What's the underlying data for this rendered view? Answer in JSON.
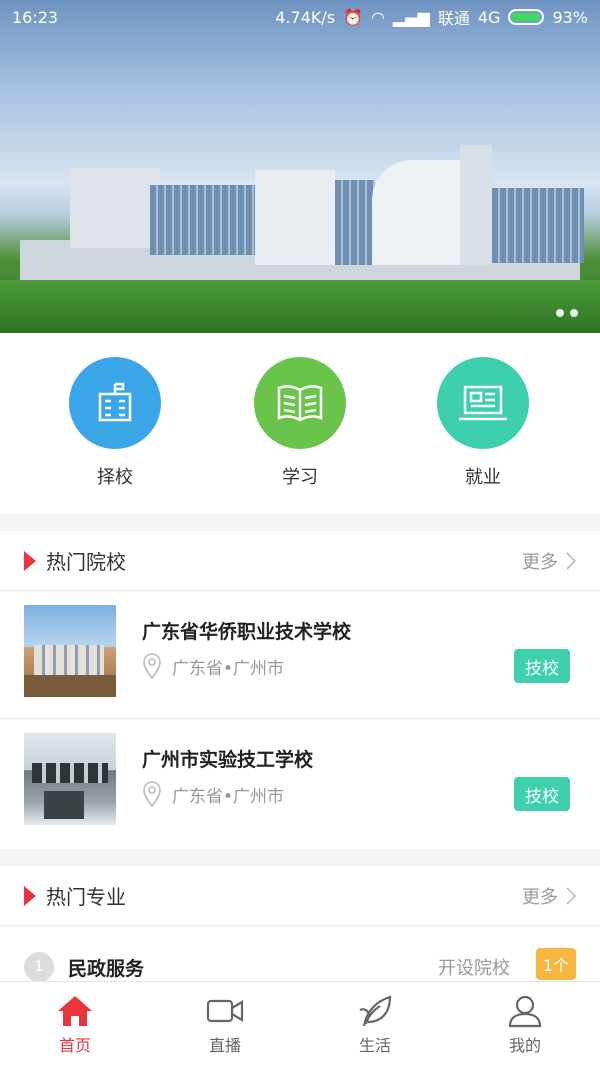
{
  "status": {
    "time": "16:23",
    "speed": "4.74K/s",
    "carrier": "联通",
    "network": "4G",
    "battery": "93%"
  },
  "banner": {
    "page_count": 2
  },
  "quick_actions": [
    {
      "label": "择校",
      "color": "#3aa6e8",
      "icon": "school-building-icon"
    },
    {
      "label": "学习",
      "color": "#6ac34b",
      "icon": "open-book-icon"
    },
    {
      "label": "就业",
      "color": "#3ecfae",
      "icon": "laptop-icon"
    }
  ],
  "hot_schools": {
    "title": "热门院校",
    "more": "更多",
    "items": [
      {
        "name": "广东省华侨职业技术学校",
        "location": "广东省•广州市",
        "type": "技校"
      },
      {
        "name": "广州市实验技工学校",
        "location": "广东省•广州市",
        "type": "技校"
      }
    ]
  },
  "hot_majors": {
    "title": "热门专业",
    "more": "更多",
    "items": [
      {
        "rank": "1",
        "name": "民政服务",
        "open_label": "开设院校",
        "count": "1个"
      }
    ]
  },
  "tabs": [
    {
      "label": "首页",
      "icon": "home-icon",
      "active": true
    },
    {
      "label": "直播",
      "icon": "video-camera-icon",
      "active": false
    },
    {
      "label": "生活",
      "icon": "leaf-icon",
      "active": false
    },
    {
      "label": "我的",
      "icon": "user-icon",
      "active": false
    }
  ],
  "colors": {
    "accent": "#e8363d",
    "badge": "#3ecfae",
    "count_badge": "#f6b640"
  }
}
